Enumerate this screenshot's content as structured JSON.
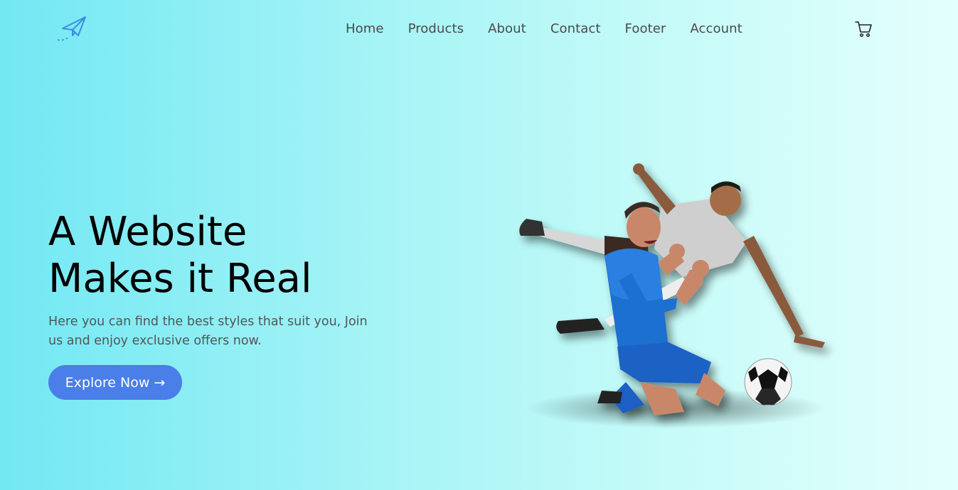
{
  "nav": {
    "items": [
      {
        "label": "Home"
      },
      {
        "label": "Products"
      },
      {
        "label": "About"
      },
      {
        "label": "Contact"
      },
      {
        "label": "Footer"
      },
      {
        "label": "Account"
      }
    ],
    "logo_icon": "paper-plane-icon",
    "cart_icon": "shopping-cart-icon"
  },
  "hero": {
    "title_line1": "A Website",
    "title_line2": "Makes it Real",
    "subtitle": "Here you can find the best styles that suit you, Join us and enjoy exclusive offers now.",
    "cta_label": "Explore Now →"
  },
  "colors": {
    "accent": "#4a7ee8",
    "bg_start": "#72e8f3",
    "bg_end": "#e4fffd"
  }
}
